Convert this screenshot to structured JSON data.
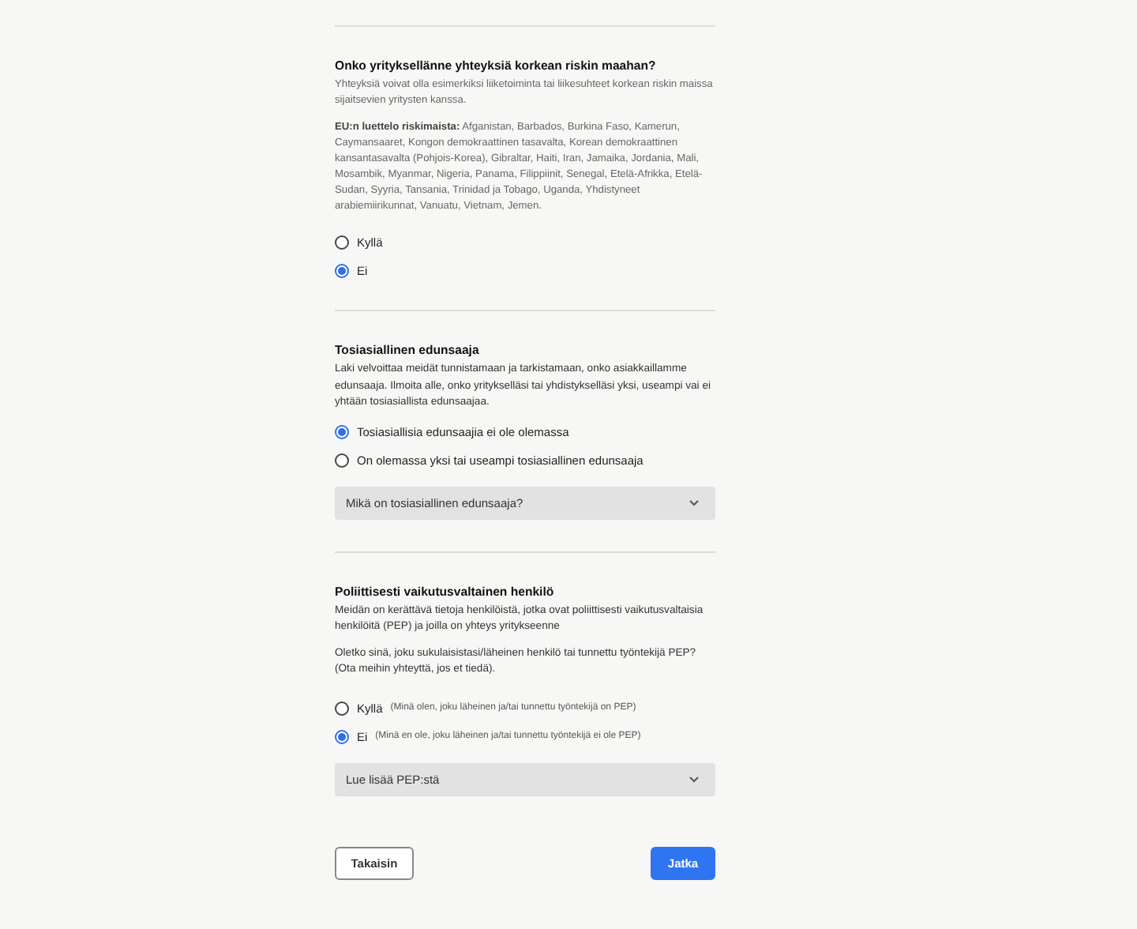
{
  "sections": [
    {
      "title": "Onko yrityksellänne yhteyksiä korkean riskin maahan?",
      "paragraphs": [
        {
          "kind": "muted",
          "text": "Yhteyksiä voivat olla esimerkiksi liiketoiminta tai liikesuhteet korkean riskin maissa sijaitsevien yritysten kanssa."
        },
        {
          "kind": "muted",
          "text": "**EU:n luettelo riskimaista:** Afganistan, Barbados, Burkina Faso, Kamerun, Caymansaaret, Kongon demokraattinen tasavalta, Korean demokraattinen kansantasavalta (Pohjois-Korea), Gibraltar, Haiti, Iran, Jamaika, Jordania, Mali, Mosambik, Myanmar, Nigeria, Panama, Filippiinit, Senegal, Etelä-Afrikka, Etelä-Sudan, Syyria, Tansania, Trinidad ja Tobago, Uganda, Yhdistyneet arabiemiirikunnat, Vanuatu, Vietnam, Jemen."
        }
      ],
      "options": [
        {
          "label": "Kyllä",
          "selected": false
        },
        {
          "label": "Ei",
          "selected": true
        }
      ]
    },
    {
      "title": "Tosiasiallinen edunsaaja",
      "paragraphs": [
        {
          "kind": "body",
          "text": "Laki velvoittaa meidät tunnistamaan ja tarkistamaan, onko asiakkaillamme edunsaaja. Ilmoita alle, onko yritykselläsi tai yhdistykselläsi yksi, useampi vai ei yhtään tosiasiallista edunsaajaa."
        }
      ],
      "options": [
        {
          "label": "Tosiasiallisia edunsaajia ei ole olemassa",
          "selected": true
        },
        {
          "label": "On olemassa yksi tai useampi tosiasiallinen edunsaaja",
          "selected": false
        }
      ],
      "accordion": {
        "label": "Mikä on tosiasiallinen edunsaaja?",
        "expanded": false
      }
    },
    {
      "title": "Poliittisesti vaikutusvaltainen henkilö",
      "paragraphs": [
        {
          "kind": "body",
          "text": "Meidän on kerättävä tietoja henkilöistä, jotka ovat poliittisesti vaikutusvaltaisia henkilöitä (PEP) ja joilla on yhteys yritykseenne"
        },
        {
          "kind": "body",
          "text": "Oletko sinä, joku sukulaisistasi/läheinen henkilö tai tunnettu työntekijä PEP? (Ota meihin yhteyttä, jos et tiedä)."
        }
      ],
      "options": [
        {
          "label": "Kyllä",
          "note": "(Minä olen, joku läheinen ja/tai tunnettu työntekijä on PEP)",
          "selected": false
        },
        {
          "label": "Ei",
          "note": "(Minä en ole, joku läheinen ja/tai tunnettu työntekijä ei ole PEP)",
          "selected": true
        }
      ],
      "accordion": {
        "label": "Lue lisää PEP:stä",
        "expanded": false
      }
    }
  ],
  "buttons": [
    {
      "kind": "secondary",
      "label": "Takaisin"
    },
    {
      "kind": "primary",
      "label": "Jatka"
    }
  ]
}
